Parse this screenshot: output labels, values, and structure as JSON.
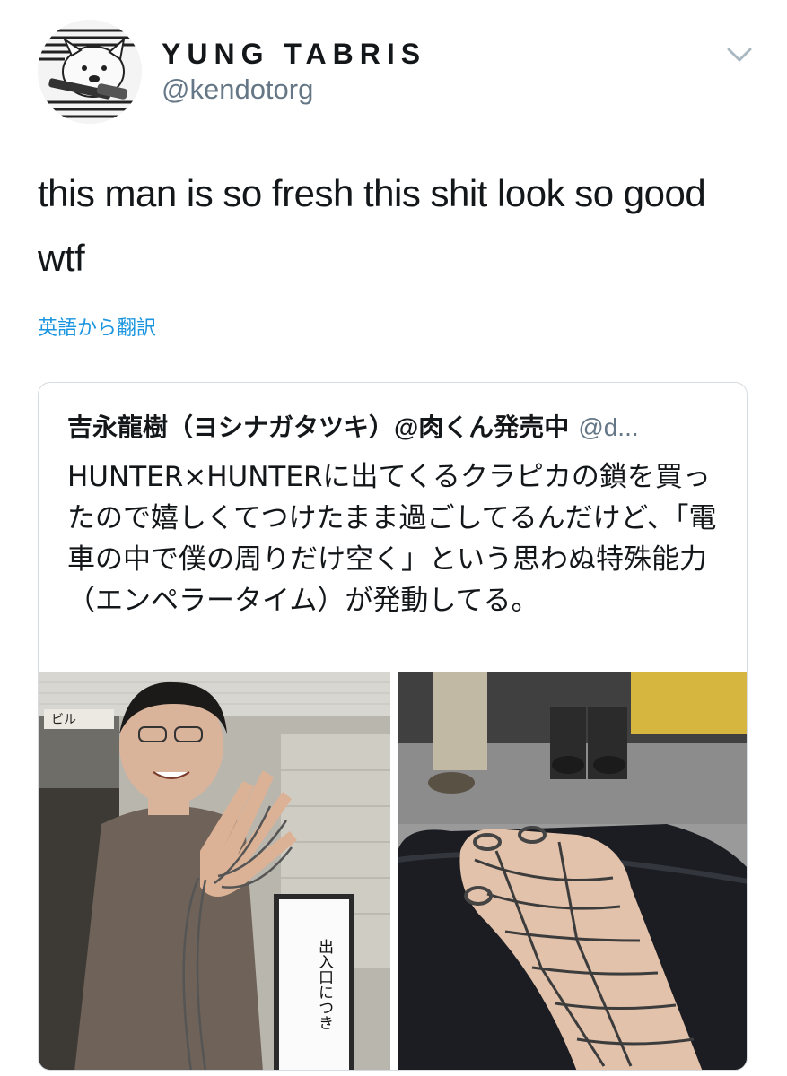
{
  "author": {
    "display_name": "YUNG TABRIS",
    "handle": "@kendotorg"
  },
  "tweet": {
    "text": "this man is so fresh this shit look so good wtf",
    "translate_label": "英語から翻訳"
  },
  "quoted_tweet": {
    "name": "吉永龍樹（ヨシナガタツキ）@肉くん発売中",
    "handle": "@d...",
    "text": "HUNTER×HUNTERに出てくるクラピカの鎖を買ったので嬉しくてつけたまま過ごしてるんだけど、「電車の中で僕の周りだけ空く」という思わぬ特殊能力（エンペラータイム）が発動してる。",
    "images": [
      {
        "sign_text": "出入口につき",
        "building_sign": "ビル"
      },
      {}
    ]
  },
  "icons": {
    "menu": "chevron-down-icon",
    "avatar": "dog-with-knife-avatar"
  },
  "colors": {
    "link": "#1b95e0",
    "secondary_text": "#657786",
    "border": "#d5dbe0"
  }
}
